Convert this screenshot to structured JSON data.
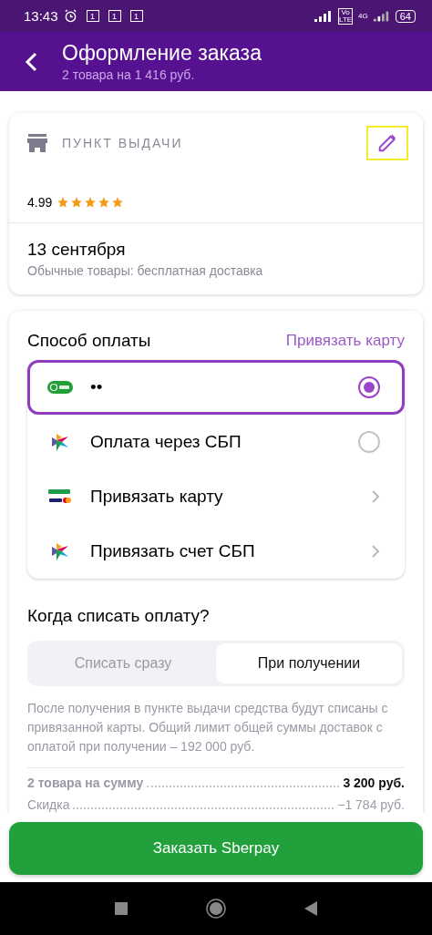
{
  "status_bar": {
    "time": "13:43",
    "notifications": [
      "1",
      "1",
      "1"
    ],
    "volte": "Vo LTE",
    "network": "4G",
    "battery": "64"
  },
  "header": {
    "title": "Оформление заказа",
    "subtitle": "2 товара на 1 416 руб."
  },
  "pickup": {
    "label": "ПУНКТ ВЫДАЧИ",
    "edit_highlighted": true,
    "rating": "4.99",
    "stars": 5,
    "date": "13 сентября",
    "note": "Обычные товары: бесплатная доставка"
  },
  "payment": {
    "title": "Способ оплаты",
    "link": "Привязать карту",
    "methods": [
      {
        "kind": "radio",
        "label": "••",
        "selected": true
      },
      {
        "kind": "radio",
        "label": "Оплата через СБП",
        "selected": false
      },
      {
        "kind": "link",
        "label": "Привязать карту"
      },
      {
        "kind": "link",
        "label": "Привязать счет СБП"
      }
    ]
  },
  "charge": {
    "title": "Когда списать оплату?",
    "options": [
      {
        "label": "Списать сразу",
        "selected": false
      },
      {
        "label": "При получении",
        "selected": true
      }
    ],
    "note": "После получения в пункте выдачи средства будут списаны с привязанной карты. Общий лимит общей суммы доставок с оплатой при получении – 192 000 руб."
  },
  "summary": [
    {
      "label": "2 товара на сумму",
      "value": "3 200 руб.",
      "emphasis": true
    },
    {
      "label": "Скидка",
      "value": "−1 784 руб.",
      "emphasis": false
    }
  ],
  "order_button": "Заказать Sberpay"
}
